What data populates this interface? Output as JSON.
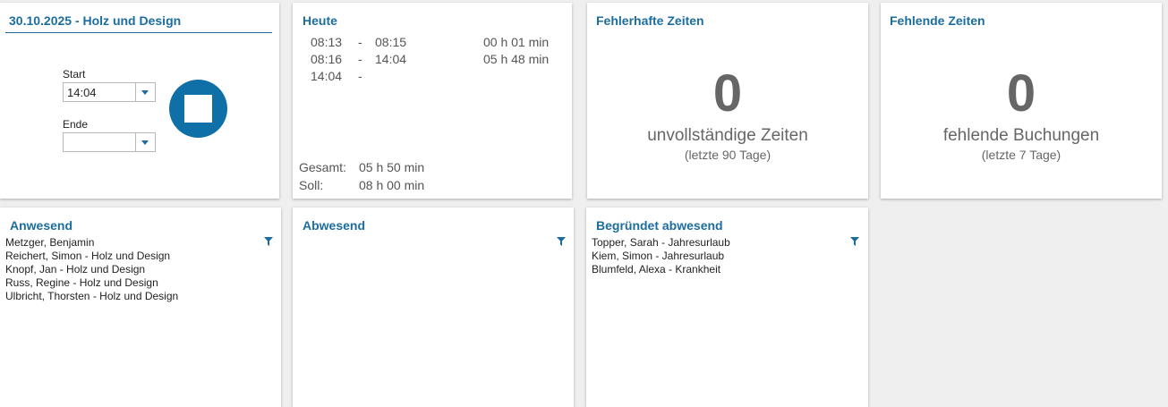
{
  "clock": {
    "title": "30.10.2025 - Holz und Design",
    "start_label": "Start",
    "start_value": "14:04",
    "end_label": "Ende",
    "end_value": ""
  },
  "today": {
    "title": "Heute",
    "entries": [
      {
        "start": "08:13",
        "dash": "-",
        "end": "08:15",
        "duration": "00 h 01 min"
      },
      {
        "start": "08:16",
        "dash": "-",
        "end": "14:04",
        "duration": "05 h 48 min"
      },
      {
        "start": "14:04",
        "dash": "-",
        "end": "",
        "duration": ""
      }
    ],
    "total_label": "Gesamt:",
    "total_value": "05 h 50 min",
    "target_label": "Soll:",
    "target_value": "08 h 00 min"
  },
  "faulty": {
    "title": "Fehlerhafte Zeiten",
    "count": "0",
    "label": "unvollständige Zeiten",
    "sub": "(letzte 90 Tage)"
  },
  "missing": {
    "title": "Fehlende Zeiten",
    "count": "0",
    "label": "fehlende Buchungen",
    "sub": "(letzte 7 Tage)"
  },
  "present": {
    "title": "Anwesend",
    "items": [
      "Metzger, Benjamin",
      "Reichert, Simon - Holz und Design",
      "Knopf, Jan - Holz und Design",
      "Russ, Regine - Holz und Design",
      "Ulbricht, Thorsten - Holz und Design"
    ]
  },
  "absent": {
    "title": "Abwesend",
    "items": []
  },
  "excused": {
    "title": "Begründet abwesend",
    "items": [
      "Topper, Sarah - Jahresurlaub",
      "Kiem, Simon - Jahresurlaub",
      "Blumfeld, Alexa - Krankheit"
    ]
  },
  "colors": {
    "accent": "#1b6da0",
    "stop_button": "#0f70a8",
    "muted_text": "#666666"
  },
  "icons": {
    "filter": "filter-icon",
    "stop": "stop-icon",
    "dropdown": "chevron-down-icon"
  }
}
